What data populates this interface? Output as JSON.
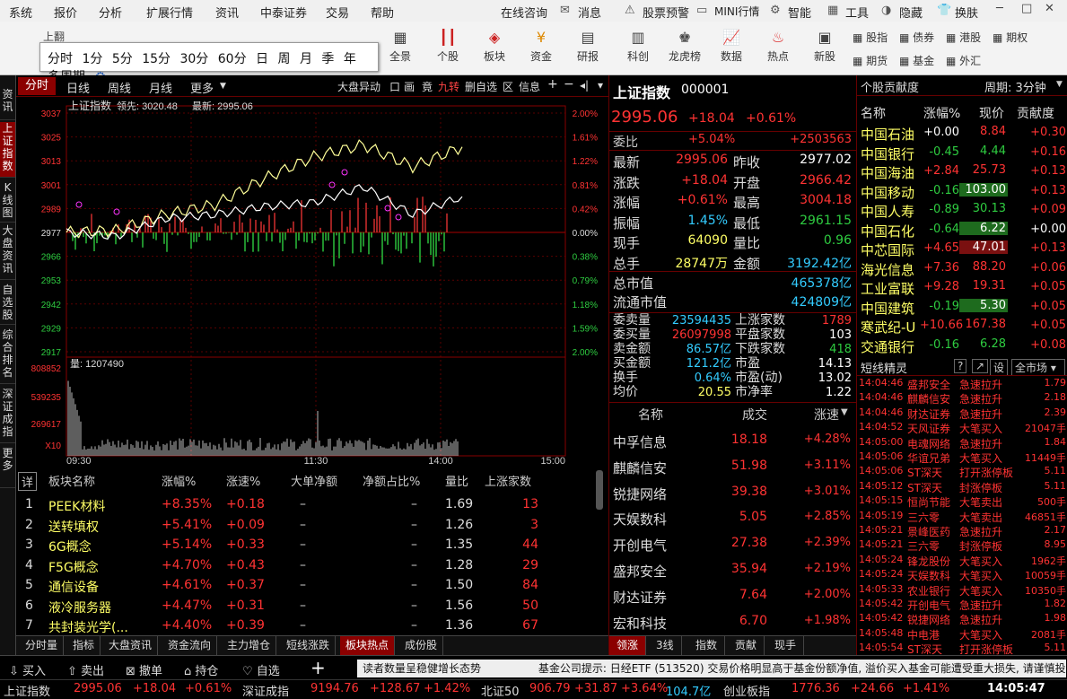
{
  "menu": [
    "系统",
    "报价",
    "分析",
    "扩展行情",
    "资讯",
    "中泰证券",
    "交易",
    "帮助"
  ],
  "menu_right": [
    "在线咨询",
    "消息",
    "股票预警",
    "MINI行情",
    "智能",
    "工具",
    "隐藏",
    "换肤"
  ],
  "toolbar": {
    "items": [
      "全景",
      "个股",
      "板块",
      "资金",
      "研报",
      "科创",
      "龙虎榜",
      "数据",
      "热点",
      "新股"
    ],
    "small": [
      "上翻"
    ],
    "right": [
      "股指",
      "债券",
      "港股",
      "期权",
      "期货",
      "基金",
      "外汇"
    ]
  },
  "periods": [
    "分时",
    "1分",
    "5分",
    "15分",
    "30分",
    "60分",
    "日",
    "周",
    "月",
    "季",
    "年",
    "多周期"
  ],
  "left_nav": [
    "资讯",
    "上证指数",
    "K线图",
    "大盘资讯",
    "自选股",
    "综合排名",
    "深证成指",
    "更多"
  ],
  "chart_tabs": {
    "left": [
      "分时",
      "日线",
      "周线",
      "月线",
      "更多"
    ],
    "right": [
      "大盘异动",
      "口",
      "画",
      "竟",
      "九转",
      "删自选",
      "区",
      "信息"
    ]
  },
  "chart": {
    "title": "上证指数",
    "lead_label": "领先: 3020.48",
    "last_label": "最新: 2995.06",
    "y_left": [
      "3037",
      "3025",
      "3013",
      "3001",
      "2989",
      "2977",
      "2966",
      "2953",
      "2942",
      "2929",
      "2917"
    ],
    "y_right": [
      "2.00%",
      "1.61%",
      "1.22%",
      "0.81%",
      "0.42%",
      "0.00%",
      "0.38%",
      "0.79%",
      "1.18%",
      "1.59%",
      "2.00%"
    ],
    "volume_label": "量: 1207490",
    "vol_axis": [
      "808852",
      "539235",
      "269617",
      "X10"
    ],
    "times": [
      "09:30",
      "11:30",
      "14:00",
      "15:00"
    ],
    "prev_close": 2977.02
  },
  "chart_data": {
    "type": "line",
    "x": [
      "09:30",
      "10:00",
      "10:30",
      "11:00",
      "11:30",
      "13:30",
      "14:00",
      "14:30",
      "15:00"
    ],
    "series": [
      {
        "values": [
          2977,
          2978,
          2986,
          2991,
          3004,
          3015,
          3021,
          3010,
          3020
        ]
      },
      {
        "values": [
          2977,
          2975,
          2984,
          2986,
          2990,
          2992,
          3000,
          2986,
          2995
        ]
      }
    ],
    "ylim": [
      2917,
      3037
    ]
  },
  "sectors": {
    "headers": [
      "详",
      "板块名称",
      "涨幅%",
      "涨速%",
      "大单净额",
      "净额占比%",
      "量比",
      "上涨家数"
    ],
    "rows": [
      [
        "1",
        "PEEK材料",
        "+8.35%",
        "+0.18",
        "–",
        "–",
        "1.69",
        "13"
      ],
      [
        "2",
        "送转填权",
        "+5.41%",
        "+0.09",
        "–",
        "–",
        "1.26",
        "3"
      ],
      [
        "3",
        "6G概念",
        "+5.14%",
        "+0.33",
        "–",
        "–",
        "1.35",
        "44"
      ],
      [
        "4",
        "F5G概念",
        "+4.70%",
        "+0.43",
        "–",
        "–",
        "1.28",
        "29"
      ],
      [
        "5",
        "通信设备",
        "+4.61%",
        "+0.37",
        "–",
        "–",
        "1.50",
        "84"
      ],
      [
        "6",
        "液冷服务器",
        "+4.47%",
        "+0.31",
        "–",
        "–",
        "1.56",
        "50"
      ],
      [
        "7",
        "共封装光学(...",
        "+4.40%",
        "+0.39",
        "–",
        "–",
        "1.36",
        "67"
      ]
    ]
  },
  "bottom_tabs": [
    "分时量",
    "指标",
    "大盘资讯",
    "资金流向",
    "主力增仓",
    "短线涨跌",
    "板块热点",
    "成份股"
  ],
  "quote": {
    "name": "上证指数",
    "code": "000001",
    "price": "2995.06",
    "change": "+18.04",
    "pct": "+0.61%",
    "webi_label": "委比",
    "webi": "+5.04%",
    "webi_vol": "+2503563",
    "stats": [
      [
        "最新",
        "2995.06",
        "昨收",
        "2977.02"
      ],
      [
        "涨跌",
        "+18.04",
        "开盘",
        "2966.42"
      ],
      [
        "涨幅",
        "+0.61%",
        "最高",
        "3004.18"
      ],
      [
        "振幅",
        "1.45%",
        "最低",
        "2961.15"
      ],
      [
        "现手",
        "64090",
        "量比",
        "0.96"
      ],
      [
        "总手",
        "28747万",
        "金额",
        "3192.42亿"
      ]
    ],
    "caps": [
      [
        "总市值",
        "465378亿"
      ],
      [
        "流通市值",
        "424809亿"
      ]
    ],
    "depth": [
      [
        "委卖量",
        "23594435",
        "上涨家数",
        "1789"
      ],
      [
        "委买量",
        "26097998",
        "平盘家数",
        "103"
      ],
      [
        "卖金额",
        "86.57亿",
        "下跌家数",
        "418"
      ],
      [
        "买金额",
        "121.2亿",
        "市盈",
        "14.13"
      ],
      [
        "换手",
        "0.64%",
        "市盈(动)",
        "13.02"
      ],
      [
        "均价",
        "20.55",
        "市净率",
        "1.22"
      ]
    ],
    "movers_headers": [
      "名称",
      "成交",
      "涨速"
    ],
    "movers": [
      [
        "中孚信息",
        "18.18",
        "+4.28%"
      ],
      [
        "麒麟信安",
        "51.98",
        "+3.11%"
      ],
      [
        "锐捷网络",
        "39.38",
        "+3.01%"
      ],
      [
        "天娱数科",
        "5.05",
        "+2.85%"
      ],
      [
        "开创电气",
        "27.38",
        "+2.39%"
      ],
      [
        "盛邦安全",
        "35.94",
        "+2.19%"
      ],
      [
        "财达证券",
        "7.64",
        "+2.00%"
      ],
      [
        "宏和科技",
        "6.70",
        "+1.98%"
      ]
    ],
    "tabs": [
      "领涨",
      "3线",
      "指数",
      "贡献",
      "现手"
    ]
  },
  "contrib": {
    "title": "个股贡献度",
    "period": "周期: 3分钟",
    "headers": [
      "名称",
      "涨幅%",
      "现价",
      "贡献度"
    ],
    "rows": [
      [
        "中国石油",
        "+0.00",
        "8.84",
        "+0.30"
      ],
      [
        "中国银行",
        "-0.45",
        "4.44",
        "+0.16"
      ],
      [
        "中国海油",
        "+2.84",
        "25.73",
        "+0.13"
      ],
      [
        "中国移动",
        "-0.16",
        "103.00",
        "+0.13"
      ],
      [
        "中国人寿",
        "-0.89",
        "30.13",
        "+0.09"
      ],
      [
        "中国石化",
        "-0.64",
        "6.22",
        "+0.00"
      ],
      [
        "中芯国际",
        "+4.65",
        "47.01",
        "+0.13"
      ],
      [
        "海光信息",
        "+7.36",
        "88.20",
        "+0.06"
      ],
      [
        "工业富联",
        "+9.28",
        "19.31",
        "+0.05"
      ],
      [
        "中国建筑",
        "-0.19",
        "5.30",
        "+0.05"
      ],
      [
        "寒武纪-U",
        "+10.66",
        "167.38",
        "+0.05"
      ],
      [
        "交通银行",
        "-0.16",
        "6.28",
        "+0.08"
      ]
    ]
  },
  "short": {
    "title": "短线精灵",
    "btns": [
      "?",
      "↗",
      "设"
    ],
    "filter": "全市场",
    "rows": [
      [
        "14:04:46",
        "盛邦安全",
        "急速拉升",
        "1.79"
      ],
      [
        "14:04:46",
        "麒麟信安",
        "急速拉升",
        "2.18"
      ],
      [
        "14:04:46",
        "财达证券",
        "急速拉升",
        "2.39"
      ],
      [
        "14:04:52",
        "天风证券",
        "大笔买入",
        "21047手"
      ],
      [
        "14:05:00",
        "电魂网络",
        "急速拉升",
        "1.84"
      ],
      [
        "14:05:06",
        "华谊兄弟",
        "大笔买入",
        "11449手"
      ],
      [
        "14:05:06",
        "ST深天",
        "打开涨停板",
        "5.11"
      ],
      [
        "14:05:12",
        "ST深天",
        "封涨停板",
        "5.11"
      ],
      [
        "14:05:15",
        "恒尚节能",
        "大笔卖出",
        "500手"
      ],
      [
        "14:05:19",
        "三六零",
        "大笔卖出",
        "46851手"
      ],
      [
        "14:05:21",
        "景峰医药",
        "急速拉升",
        "2.17"
      ],
      [
        "14:05:21",
        "三六零",
        "封涨停板",
        "8.95"
      ],
      [
        "14:05:24",
        "锋龙股份",
        "大笔买入",
        "1962手"
      ],
      [
        "14:05:24",
        "天娱数科",
        "大笔买入",
        "10059手"
      ],
      [
        "14:05:33",
        "农业银行",
        "大笔买入",
        "10350手"
      ],
      [
        "14:05:42",
        "开创电气",
        "急速拉升",
        "1.82"
      ],
      [
        "14:05:42",
        "锐捷网络",
        "急速拉升",
        "1.98"
      ],
      [
        "14:05:48",
        "中电港",
        "大笔买入",
        "2081手"
      ],
      [
        "14:05:54",
        "ST深天",
        "打开涨停板",
        "5.11"
      ]
    ]
  },
  "trade": {
    "items": [
      "买入",
      "卖出",
      "撤单",
      "持仓",
      "自选"
    ],
    "plus": "+",
    "ticker": "读者数量呈稳健增长态势",
    "notice": "基金公司提示: 日经ETF (513520) 交易价格明显高于基金份额净值, 溢价买入基金可能遭受重大损失, 请谨慎投"
  },
  "status": [
    [
      "上证指数",
      "2995.06",
      "+18.04",
      "+0.61%"
    ],
    [
      "深证成指",
      "9194.76",
      "+128.67",
      "+1.42%"
    ],
    [
      "北证50",
      "906.79",
      "+31.87",
      "+3.64%"
    ],
    [
      "",
      "104.7亿",
      "",
      ""
    ],
    [
      "创业板指",
      "1776.36",
      "+24.66",
      "+1.41%"
    ]
  ],
  "clock": "14:05:47"
}
